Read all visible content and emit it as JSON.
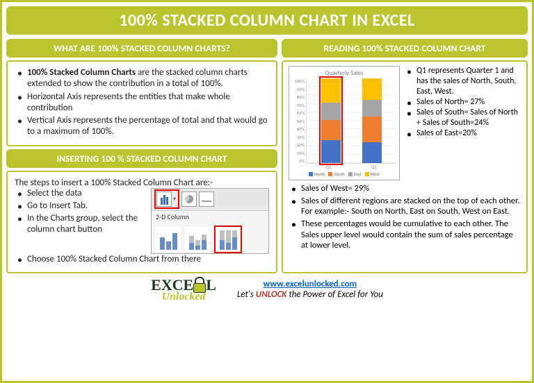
{
  "title": "100% STACKED COLUMN CHART IN EXCEL",
  "left": {
    "header1": "WHAT ARE 100% STACKED COLUMN CHARTS?",
    "what_bold": "100% Stacked Column Charts",
    "what_rest": " are the stacked column charts extended to show the contribution in a total of 100%.",
    "what_b2": "Horizontal Axis represents the entities that make whole contribution",
    "what_b3": "Vertical Axis represents the percentage of total and that would go to a maximum of 100%.",
    "header2": "INSERTING 100 % STACKED COLUMN CHART",
    "insert_intro": "The steps to insert a 100% Stacked Column Chart are:-",
    "insert_b1": "Select the data",
    "insert_b2": "Go to Insert Tab.",
    "insert_b3": "In the Charts group, select the column chart button",
    "insert_b4": "Choose 100% Stacked Column Chart from there",
    "ribbon_label": "2-D Column"
  },
  "right": {
    "header": "READING 100% STACKED COLUMN CHART",
    "side_b1": "Q1 represents Quarter 1 and has the sales of North, South, East, West.",
    "side_b2": "Sales of North= 27%",
    "side_b3": "Sales of South= Sales of North + Sales of South=24%",
    "side_b4": "Sales of East=20%",
    "below_b1": "Sales of West= 29%",
    "below_b2": "Sales of different regions are stacked on the top of each other. For example:-  South on North, East on South, West on East.",
    "below_b3": "These percentages would be cumulative to each other. The Sales upper level would contain the sum of sales percentage at lower level."
  },
  "chart_data": {
    "type": "stacked-bar-100",
    "title": "Quarterly Sales",
    "ylabel": "",
    "ylim": [
      0,
      100
    ],
    "yticks": [
      "100%",
      "90%",
      "80%",
      "70%",
      "60%",
      "50%",
      "40%",
      "30%",
      "20%",
      "10%",
      "0%"
    ],
    "categories": [
      "Q1",
      "Q2"
    ],
    "series": [
      {
        "name": "North",
        "color": "#4472c4",
        "values": [
          27,
          25
        ]
      },
      {
        "name": "South",
        "color": "#ed7d31",
        "values": [
          24,
          30
        ]
      },
      {
        "name": "East",
        "color": "#a5a5a5",
        "values": [
          20,
          20
        ]
      },
      {
        "name": "West",
        "color": "#ffc000",
        "values": [
          29,
          25
        ]
      }
    ]
  },
  "footer": {
    "logo_top": "EXCE",
    "logo_L": "L",
    "logo_bottom": "Unlocked",
    "url": "www.excelunlocked.com",
    "tag_before": "Let's ",
    "tag_unlock": "UNLOCK",
    "tag_after": " the Power of Excel for You"
  }
}
